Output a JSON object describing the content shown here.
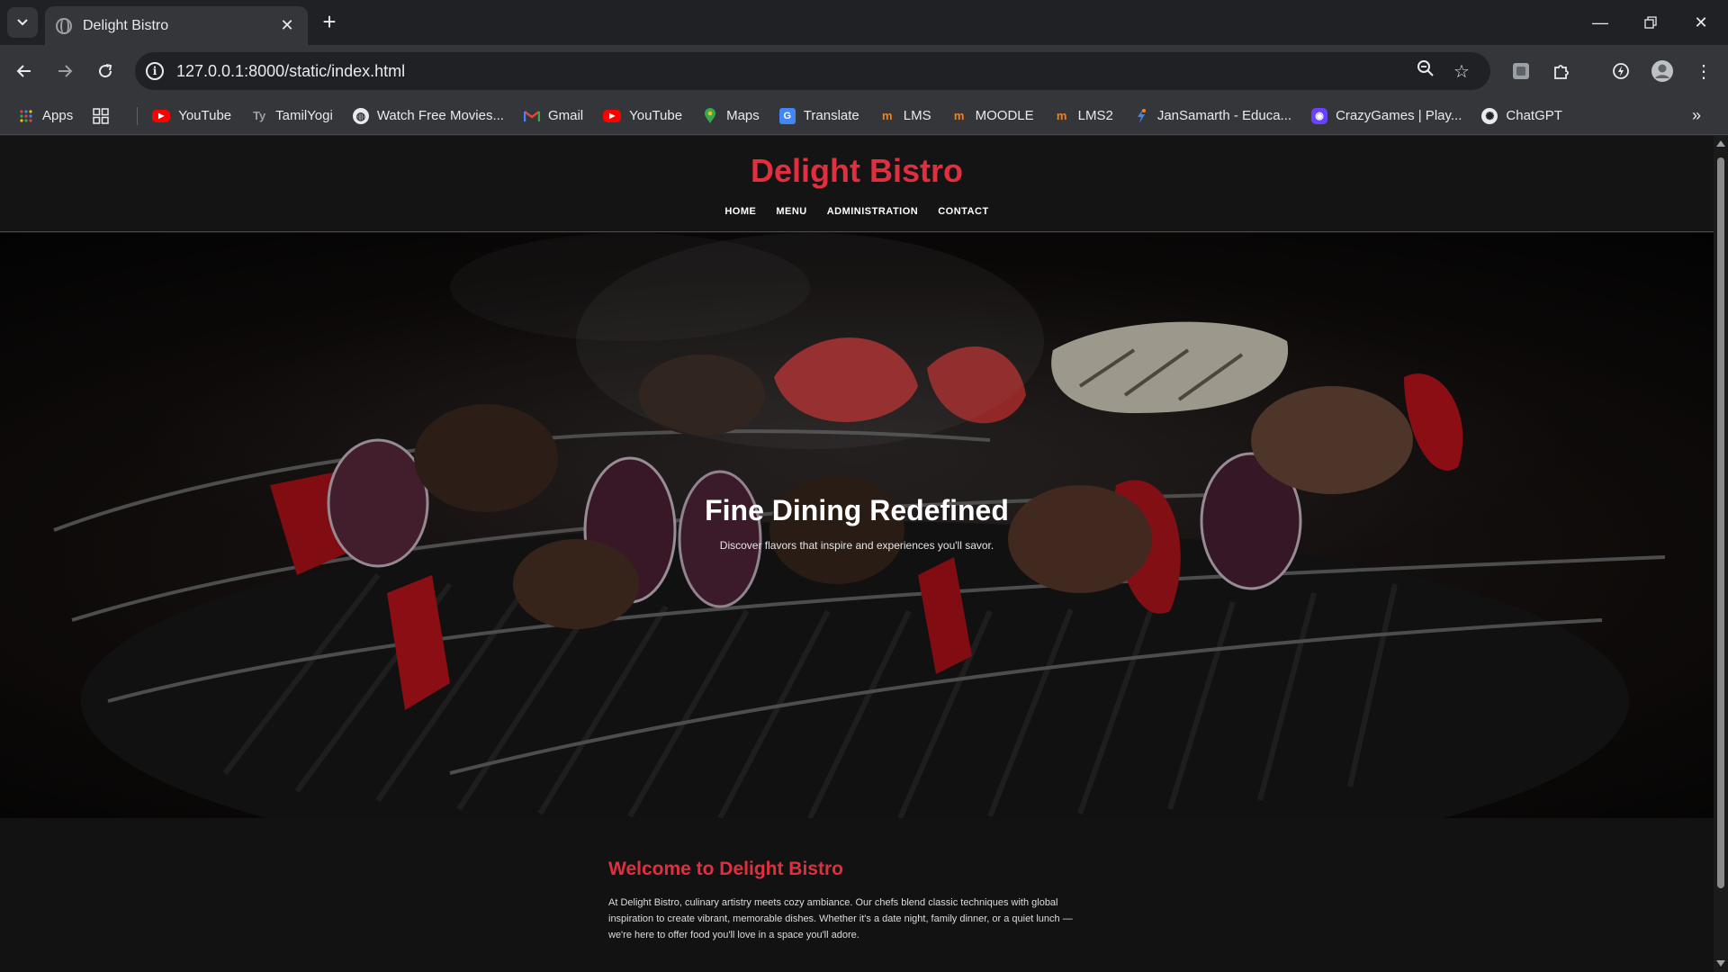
{
  "browser": {
    "tab_title": "Delight Bistro",
    "url": "127.0.0.1:8000/static/index.html",
    "bookmarks": [
      {
        "label": "Apps",
        "icon": "apps-grid-icon"
      },
      {
        "label": "YouTube",
        "icon": "youtube-icon"
      },
      {
        "label": "TamilYogi",
        "icon": "tamilyogi-icon"
      },
      {
        "label": "Watch Free Movies...",
        "icon": "globe-icon"
      },
      {
        "label": "Gmail",
        "icon": "gmail-icon"
      },
      {
        "label": "YouTube",
        "icon": "youtube-icon"
      },
      {
        "label": "Maps",
        "icon": "maps-icon"
      },
      {
        "label": "Translate",
        "icon": "translate-icon"
      },
      {
        "label": "LMS",
        "icon": "moodle-icon"
      },
      {
        "label": "MOODLE",
        "icon": "moodle-icon"
      },
      {
        "label": "LMS2",
        "icon": "moodle-icon"
      },
      {
        "label": "JanSamarth - Educa...",
        "icon": "jansamarth-icon"
      },
      {
        "label": "CrazyGames | Play...",
        "icon": "crazygames-icon"
      },
      {
        "label": "ChatGPT",
        "icon": "chatgpt-icon"
      }
    ]
  },
  "site": {
    "brand": "Delight Bistro",
    "nav": [
      "HOME",
      "MENU",
      "ADMINISTRATION",
      "CONTACT"
    ],
    "hero": {
      "title": "Fine Dining Redefined",
      "subtitle": "Discover flavors that inspire and experiences you'll savor."
    },
    "welcome": {
      "title": "Welcome to Delight Bistro",
      "text": "At Delight Bistro, culinary artistry meets cozy ambiance. Our chefs blend classic techniques with global inspiration to create vibrant, memorable dishes. Whether it's a date night, family dinner, or a quiet lunch — we're here to offer food you'll love in a space you'll adore."
    }
  },
  "colors": {
    "accent": "#e0303f",
    "page_bg": "#121212",
    "chrome_bg": "#35363a"
  }
}
